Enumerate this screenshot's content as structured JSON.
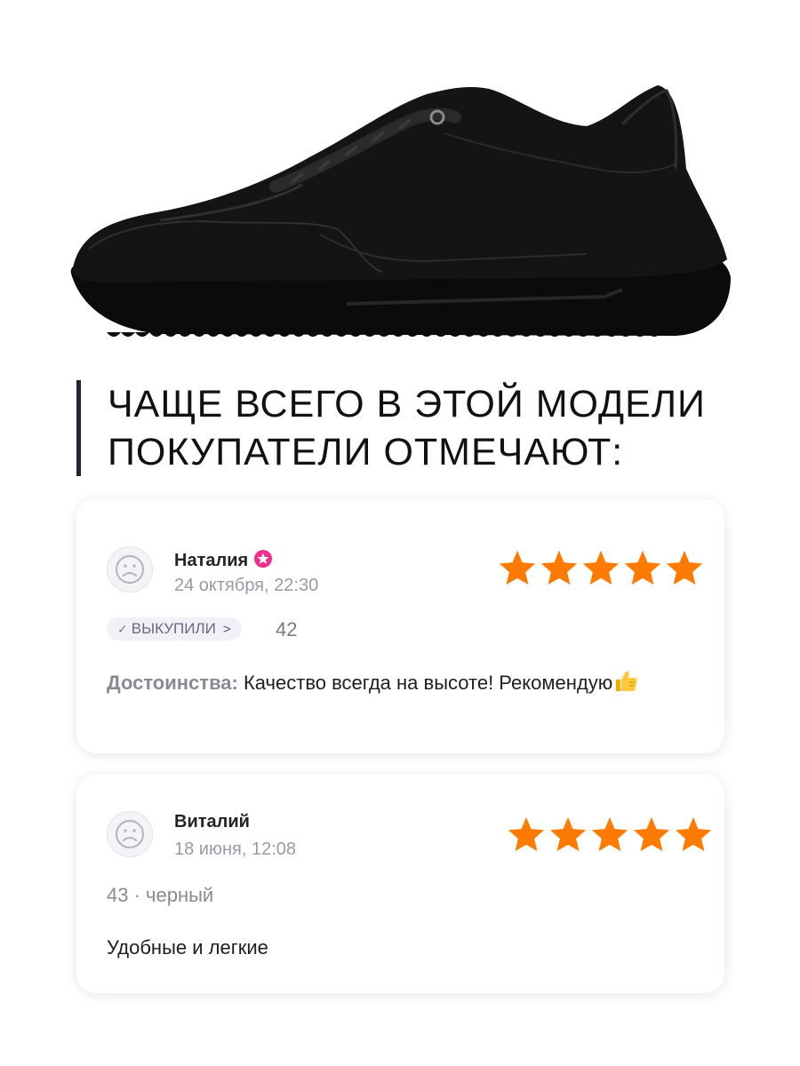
{
  "product": {
    "image_icon": "black-leather-sneaker-image"
  },
  "heading": {
    "line1": "ЧАЩЕ ВСЕГО В ЭТОЙ МОДЕЛИ",
    "line2": "ПОКУПАТЕЛИ ОТМЕЧАЮТ:",
    "accent_color": "#1c2536"
  },
  "reviews": [
    {
      "author": "Наталия",
      "has_badge": true,
      "badge_icon": "pink-star-badge-icon",
      "date": "24 октября, 22:30",
      "rating": 5,
      "purchased_label": "ВЫКУПИЛИ",
      "size": "42",
      "pros_label": "Достоинства:",
      "text": " Качество всегда на высоте! Рекомендую",
      "emoji_icon": "thumbs-up-icon"
    },
    {
      "author": "Виталий",
      "has_badge": false,
      "date": "18 июня, 12:08",
      "rating": 5,
      "meta": "43 · черный",
      "text": "Удобные и легкие"
    }
  ],
  "colors": {
    "star": "#ff7a00",
    "badge": "#ef2d8b",
    "muted_text": "#9a9aa6"
  }
}
